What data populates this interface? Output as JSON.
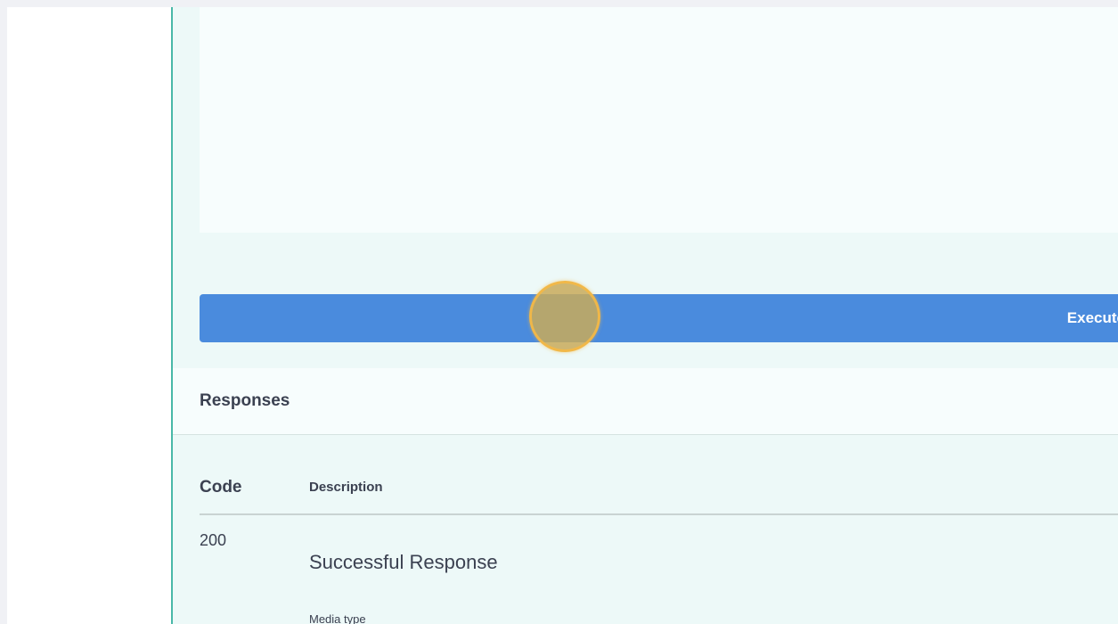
{
  "execute": {
    "label": "Execute"
  },
  "responses": {
    "title": "Responses",
    "columns": {
      "code": "Code",
      "description": "Description"
    },
    "rows": [
      {
        "code": "200",
        "description": "Successful Response",
        "media_type_label": "Media type"
      }
    ]
  },
  "colors": {
    "accent": "#4a8bdd",
    "border": "#49b8a8",
    "panel_bg": "#edf9f8",
    "text": "#3b4151"
  }
}
